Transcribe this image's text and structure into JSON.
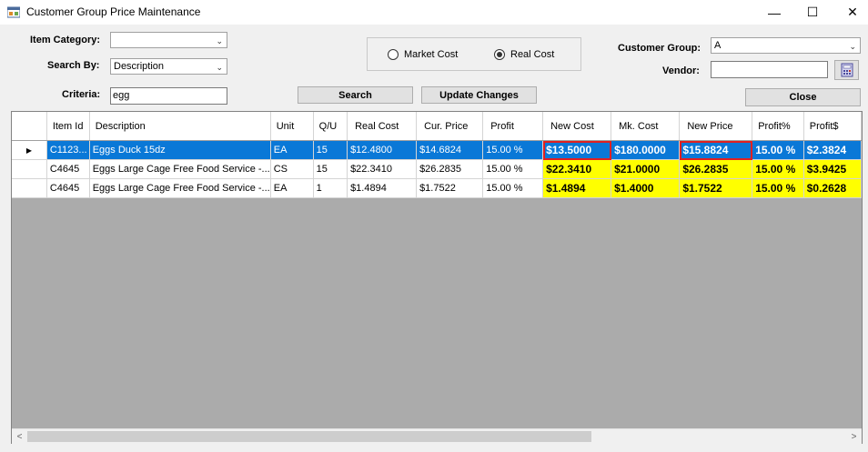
{
  "window": {
    "title": "Customer Group Price Maintenance",
    "minimize": "—",
    "maximize": "☐",
    "close": "✕"
  },
  "form": {
    "item_category_label": "Item Category:",
    "item_category_value": "",
    "search_by_label": "Search By:",
    "search_by_value": "Description",
    "criteria_label": "Criteria:",
    "criteria_value": "egg",
    "market_cost_label": "Market Cost",
    "real_cost_label": "Real Cost",
    "selected_cost": "Real Cost",
    "customer_group_label": "Customer Group:",
    "customer_group_value": "A",
    "vendor_label": "Vendor:",
    "vendor_value": "",
    "search_button": "Search",
    "update_button": "Update Changes",
    "close_button": "Close"
  },
  "grid": {
    "columns": [
      "Item Id",
      "Description",
      "Unit",
      "Q/U",
      "Real Cost",
      "Cur. Price",
      "Profit",
      "New Cost",
      "Mk. Cost",
      "New Price",
      "Profit%",
      "Profit$"
    ],
    "rows": [
      {
        "item_id": "C1123...",
        "description": "Eggs Duck 15dz",
        "unit": "EA",
        "qu": "15",
        "real_cost": "$12.4800",
        "cur_price": "$14.6824",
        "profit": "15.00 %",
        "new_cost": "$13.5000",
        "mk_cost": "$180.0000",
        "new_price": "$15.8824",
        "profit_pct": "15.00 %",
        "profit_amt": "$2.3824"
      },
      {
        "item_id": "C4645",
        "description": "Eggs Large Cage Free Food Service -...",
        "unit": "CS",
        "qu": "15",
        "real_cost": "$22.3410",
        "cur_price": "$26.2835",
        "profit": "15.00 %",
        "new_cost": "$22.3410",
        "mk_cost": "$21.0000",
        "new_price": "$26.2835",
        "profit_pct": "15.00 %",
        "profit_amt": "$3.9425"
      },
      {
        "item_id": "C4645",
        "description": "Eggs Large Cage Free Food Service -...",
        "unit": "EA",
        "qu": "1",
        "real_cost": "$1.4894",
        "cur_price": "$1.7522",
        "profit": "15.00 %",
        "new_cost": "$1.4894",
        "mk_cost": "$1.4000",
        "new_price": "$1.7522",
        "profit_pct": "15.00 %",
        "profit_amt": "$0.2628"
      }
    ],
    "selected_row": 0,
    "row_indicator": "▶"
  },
  "scrollbar": {
    "left_arrow": "<",
    "right_arrow": ">"
  },
  "colors": {
    "selection": "#0a78d7",
    "highlight": "#ffff00",
    "annotation_box": "#e02020"
  }
}
